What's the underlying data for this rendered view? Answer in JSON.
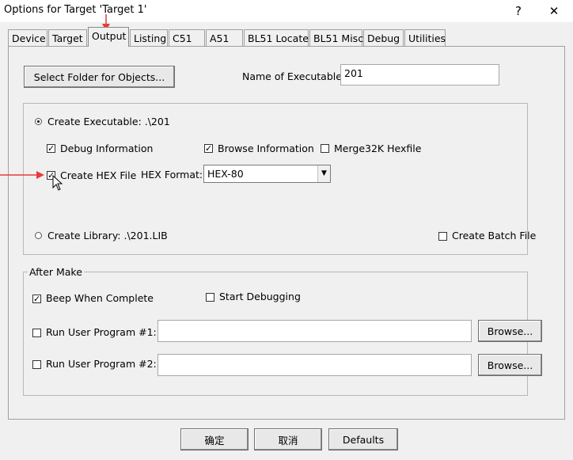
{
  "window": {
    "title": "Options for Target 'Target 1'",
    "help_button": "?",
    "close_button": "✕"
  },
  "tabs": [
    {
      "label": "Device"
    },
    {
      "label": "Target"
    },
    {
      "label": "Output"
    },
    {
      "label": "Listing"
    },
    {
      "label": "C51"
    },
    {
      "label": "A51"
    },
    {
      "label": "BL51 Locate"
    },
    {
      "label": "BL51 Misc"
    },
    {
      "label": "Debug"
    },
    {
      "label": "Utilities"
    }
  ],
  "active_tab": "Output",
  "top": {
    "select_folder_label": "Select Folder for Objects...",
    "name_label": "Name of Executable:",
    "name_value": "201"
  },
  "create_group": {
    "create_executable_label": "Create Executable:  .\\201",
    "debug_info_label": "Debug Information",
    "browse_info_label": "Browse Information",
    "merge_label": "Merge32K Hexfile",
    "create_hex_label": "Create HEX File",
    "hex_format_label": "HEX Format:",
    "hex_format_value": "HEX-80",
    "create_library_label": "Create Library:  .\\201.LIB",
    "create_batch_label": "Create Batch File"
  },
  "after_make": {
    "title": "After Make",
    "beep_label": "Beep When Complete",
    "start_debug_label": "Start Debugging",
    "run1_label": "Run User Program #1:",
    "run2_label": "Run User Program #2:",
    "run1_value": "",
    "run2_value": "",
    "browse_label": "Browse..."
  },
  "footer": {
    "ok_label": "确定",
    "cancel_label": "取消",
    "defaults_label": "Defaults"
  },
  "check_mark": "✓",
  "colors": {
    "annotation_red": "#e83b3b"
  }
}
